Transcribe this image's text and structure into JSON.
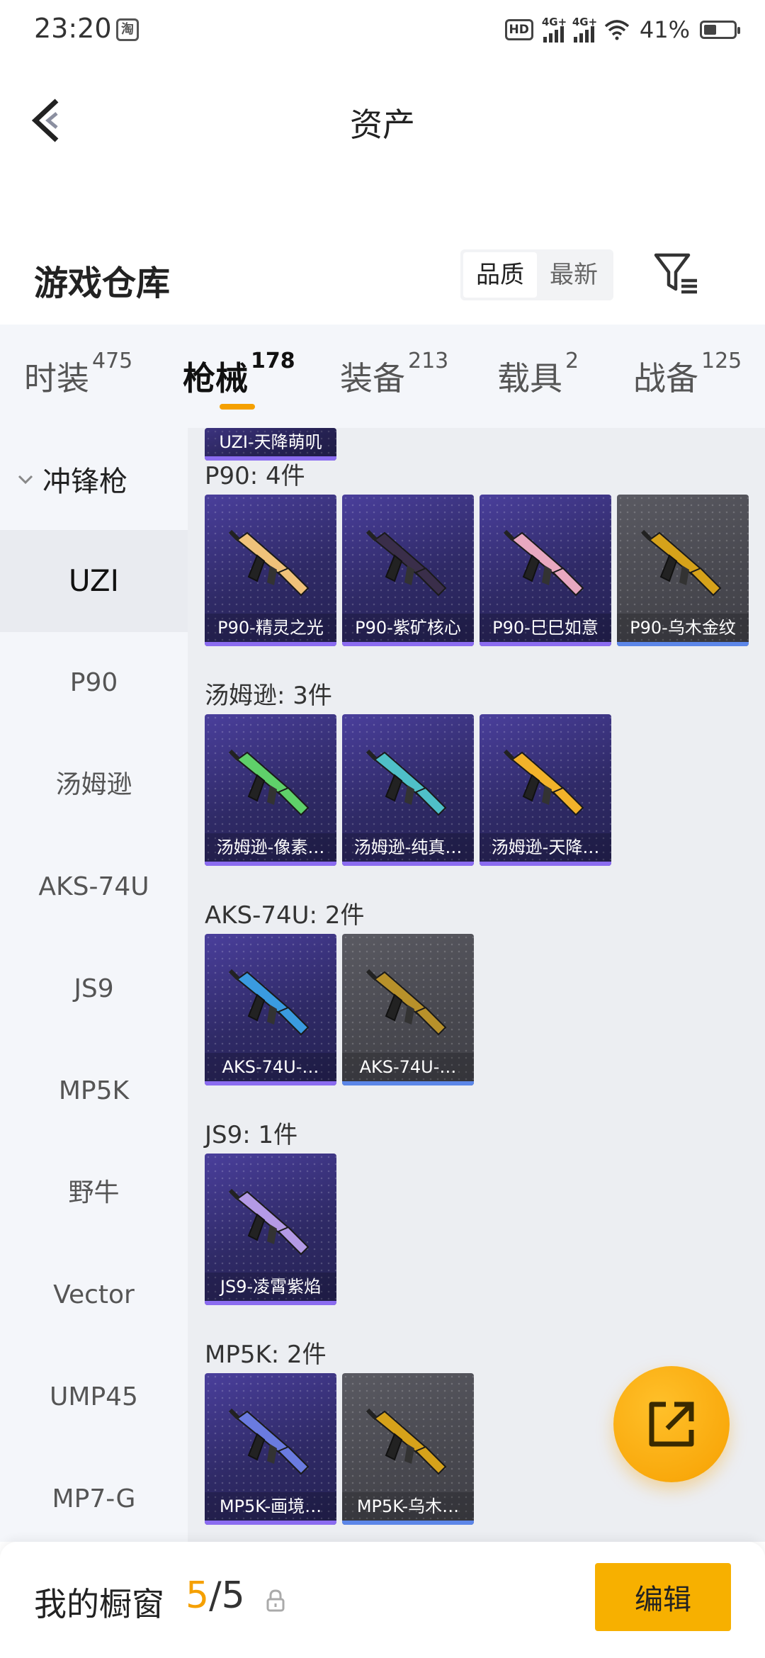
{
  "status_bar": {
    "time": "23:20",
    "app_icon": "淘",
    "hd_label": "HD",
    "network_1": "4G+",
    "network_2": "4G+",
    "battery": "41%"
  },
  "header": {
    "title": "资产"
  },
  "warehouse": {
    "title": "游戏仓库",
    "sort_options": [
      "品质",
      "最新"
    ],
    "active_sort": "品质"
  },
  "category_tabs": [
    {
      "label": "时装",
      "count": "475"
    },
    {
      "label": "枪械",
      "count": "178"
    },
    {
      "label": "装备",
      "count": "213"
    },
    {
      "label": "载具",
      "count": "2"
    },
    {
      "label": "战备",
      "count": "125"
    }
  ],
  "active_tab": "枪械",
  "sidebar": {
    "group": "冲锋枪",
    "items": [
      "UZI",
      "P90",
      "汤姆逊",
      "AKS-74U",
      "JS9",
      "MP5K",
      "野牛",
      "Vector",
      "UMP45",
      "MP7-G"
    ],
    "active": "UZI"
  },
  "content": {
    "partial_top_card": "UZI-天降萌叽",
    "groups": [
      {
        "label": "P90: 4件",
        "items": [
          {
            "name": "P90-精灵之光",
            "rarity": "purple",
            "color": "#f0c27a"
          },
          {
            "name": "P90-紫矿核心",
            "rarity": "purple",
            "color": "#3a2e4a"
          },
          {
            "name": "P90-巳巳如意",
            "rarity": "purple",
            "color": "#e8a8c0"
          },
          {
            "name": "P90-乌木金纹",
            "rarity": "gray",
            "color": "#d6a21a"
          }
        ]
      },
      {
        "label": "汤姆逊: 3件",
        "items": [
          {
            "name": "汤姆逊-像素…",
            "rarity": "purple",
            "color": "#5fd06a"
          },
          {
            "name": "汤姆逊-纯真…",
            "rarity": "purple",
            "color": "#4fc0c8"
          },
          {
            "name": "汤姆逊-天降…",
            "rarity": "purple",
            "color": "#f2b22a"
          }
        ]
      },
      {
        "label": "AKS-74U: 2件",
        "items": [
          {
            "name": "AKS-74U-…",
            "rarity": "purple",
            "color": "#3a9be0"
          },
          {
            "name": "AKS-74U-…",
            "rarity": "gray",
            "color": "#b8912a"
          }
        ]
      },
      {
        "label": "JS9: 1件",
        "items": [
          {
            "name": "JS9-凌霄紫焰",
            "rarity": "purple",
            "color": "#b49ae6"
          }
        ]
      },
      {
        "label": "MP5K: 2件",
        "items": [
          {
            "name": "MP5K-画境…",
            "rarity": "purple",
            "color": "#6a7be0"
          },
          {
            "name": "MP5K-乌木…",
            "rarity": "gray",
            "color": "#d6a21a"
          }
        ]
      }
    ]
  },
  "bottom_bar": {
    "label": "我的橱窗",
    "count_current": "5",
    "count_sep": "/",
    "count_total": "5",
    "edit_label": "编辑"
  },
  "colors": {
    "accent": "#f5a000",
    "purple_card": "#2f2a66",
    "gray_card": "#48484f"
  },
  "icons": [
    "back-icon",
    "filter-icon",
    "share-icon",
    "lock-icon",
    "chevron-down-icon"
  ]
}
